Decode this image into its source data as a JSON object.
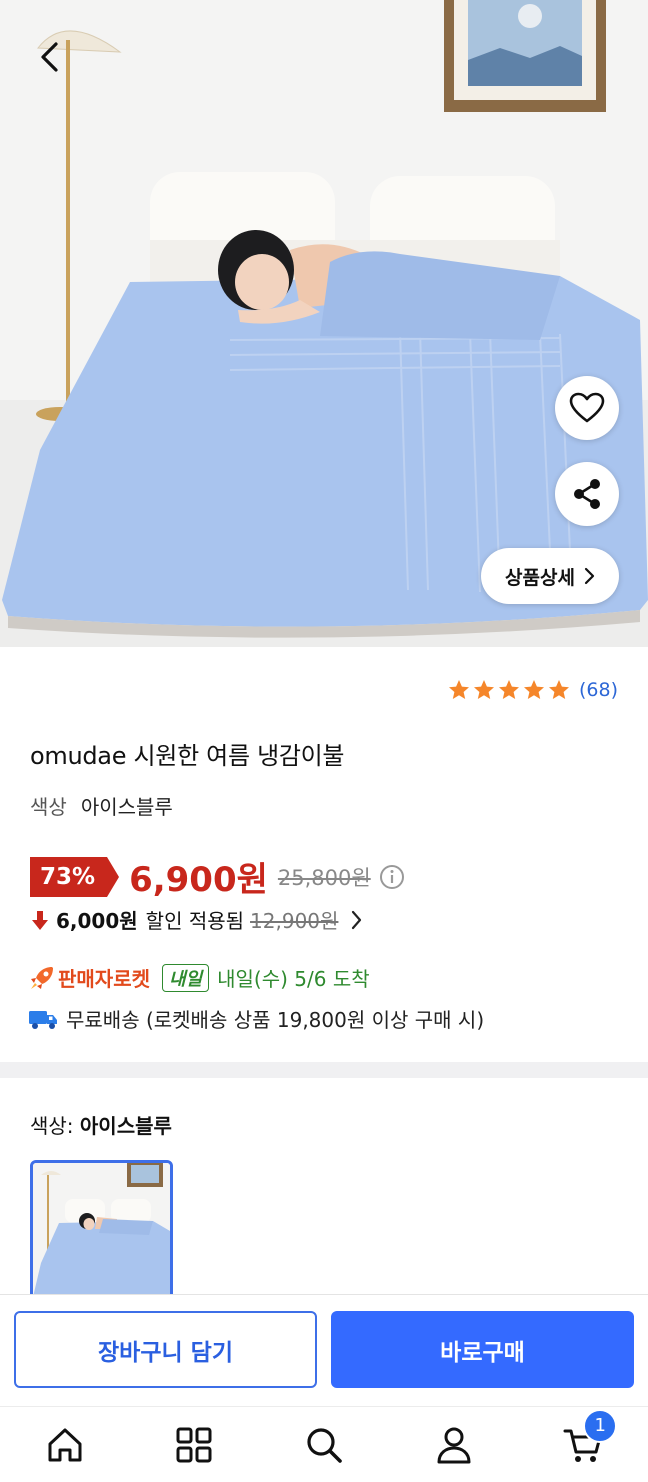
{
  "hero": {
    "detail_button_label": "상품상세"
  },
  "rating": {
    "stars": 5,
    "count": "(68)"
  },
  "product": {
    "title": "omudae 시원한 여름 냉감이불",
    "color_label": "색상",
    "color_value": "아이스블루"
  },
  "price": {
    "discount": "73%",
    "sale_price": "6,900원",
    "original_price": "25,800원"
  },
  "coupon": {
    "price": "6,000원",
    "text": "할인 적용됨",
    "original": "12,900원"
  },
  "delivery": {
    "rocket_label": "판매자로켓",
    "tomorrow_badge": "내일",
    "arrival": "내일(수) 5/6 도착",
    "shipping": "무료배송 (로켓배송 상품 19,800원 이상 구매 시)"
  },
  "option": {
    "label": "색상:",
    "selected": "아이스블루"
  },
  "actions": {
    "cart_label": "장바구니 담기",
    "buy_label": "바로구매"
  },
  "nav": {
    "items": [
      "home-icon",
      "category-icon",
      "search-icon",
      "user-icon",
      "cart-icon"
    ],
    "cart_count": "1"
  },
  "colors": {
    "accent": "#346aff",
    "sale_red": "#c8271c",
    "rocket_orange": "#e24a1c",
    "arrival_green": "#2f8a2f",
    "star": "#f5862a",
    "blanket": "#a9c4ee"
  }
}
